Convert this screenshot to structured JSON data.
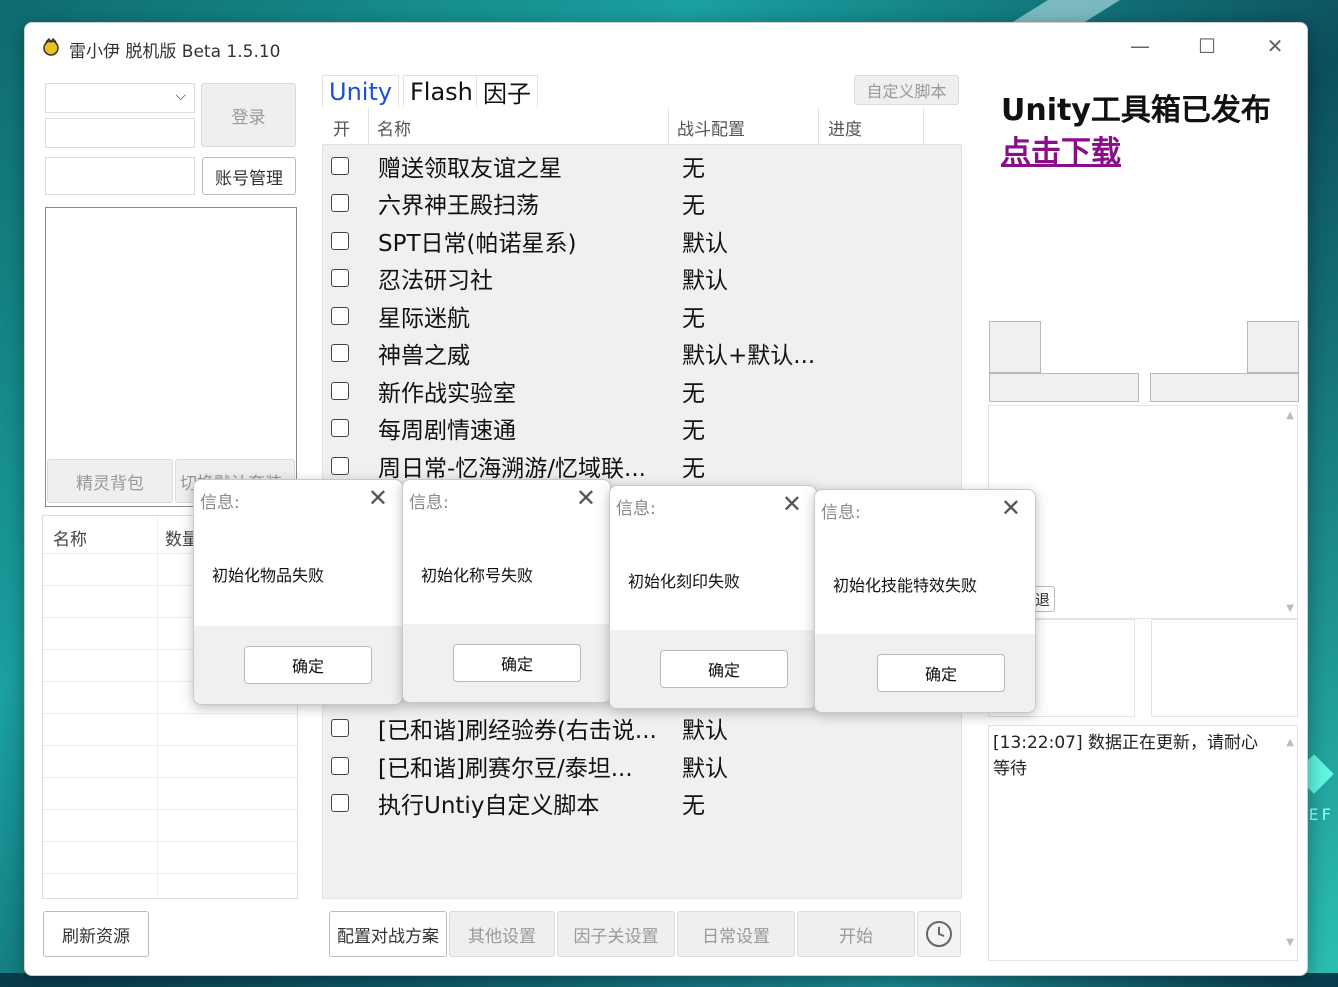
{
  "window": {
    "title": "雷小伊 脱机版 Beta 1.5.10",
    "minimize": "—",
    "maximize": "☐",
    "close": "✕"
  },
  "login": {
    "account_combo_value": "",
    "password_value": "",
    "login_button": "登录",
    "extra_value": "",
    "account_manage_button": "账号管理",
    "pet_bag_button": "精灵背包",
    "switch_button": "切换默认套装",
    "table_headers": [
      "名称",
      "数量"
    ]
  },
  "tabs": [
    "Unity",
    "Flash",
    "因子"
  ],
  "custom_script_button": "自定义脚本",
  "task_table": {
    "headers": [
      "开",
      "名称",
      "战斗配置",
      "进度"
    ],
    "rows": [
      {
        "name": "赠送领取友谊之星",
        "config": "无"
      },
      {
        "name": "六界神王殿扫荡",
        "config": "无"
      },
      {
        "name": "SPT日常(帕诺星系)",
        "config": "默认"
      },
      {
        "name": "忍法研习社",
        "config": "默认"
      },
      {
        "name": "星际迷航",
        "config": "无"
      },
      {
        "name": "神兽之威",
        "config": "默认+默认..."
      },
      {
        "name": "新作战实验室",
        "config": "无"
      },
      {
        "name": "每周剧情速通",
        "config": "无"
      },
      {
        "name": "周日常-忆海溯游/忆域联...",
        "config": "无"
      },
      {
        "name": "[已和谐]刷经验券(右击说...",
        "config": "默认"
      },
      {
        "name": "[已和谐]刷赛尔豆/泰坦...",
        "config": "默认"
      },
      {
        "name": "执行Untiy自定义脚本",
        "config": "无"
      }
    ]
  },
  "promo": {
    "title": "Unity工具箱已发布",
    "link": "点击下载"
  },
  "right_partial_text": "退",
  "log": {
    "text": "[13:22:07] 数据正在更新，请耐心等待"
  },
  "bottom": {
    "refresh_button": "刷新资源",
    "config_battle_button": "配置对战方案",
    "other_settings_button": "其他设置",
    "factor_settings_button": "因子关设置",
    "daily_settings_button": "日常设置",
    "start_button": "开始"
  },
  "dialogs": [
    {
      "title": "信息:",
      "message": "初始化物品失败",
      "ok": "确定"
    },
    {
      "title": "信息:",
      "message": "初始化称号失败",
      "ok": "确定"
    },
    {
      "title": "信息:",
      "message": "初始化刻印失败",
      "ok": "确定"
    },
    {
      "title": "信息:",
      "message": "初始化技能特效失败",
      "ok": "确定"
    }
  ],
  "colors": {
    "tab_active": "#1a4fd6",
    "link": "#8a0e8a"
  }
}
